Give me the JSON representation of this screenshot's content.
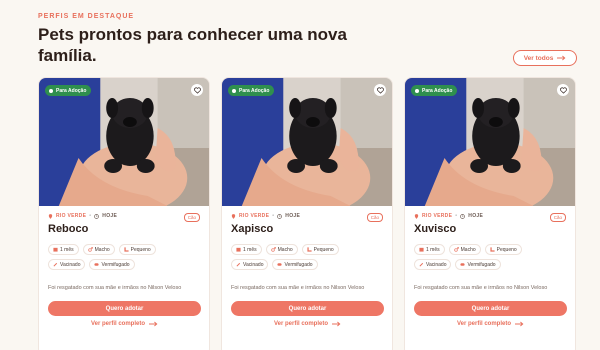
{
  "section": {
    "eyebrow": "PERFIS EM DESTAQUE",
    "headline": "Pets prontos para conhecer uma nova família.",
    "see_all": "Ver todos"
  },
  "colors": {
    "accent": "#e8705c",
    "badge_green": "#2f8f4e",
    "cta": "#ee7665"
  },
  "cards": [
    {
      "badge": "Para Adoção",
      "city": "RIO VERDE",
      "when": "HOJE",
      "species": "Cão",
      "name": "Reboco",
      "tags": [
        "1 mês",
        "Macho",
        "Pequeno",
        "Vacinado",
        "Vermifugado"
      ],
      "description": "Foi resgatado com sua mãe e irmãos no Nilson Veloso",
      "cta": "Quero adotar",
      "link": "Ver perfil completo"
    },
    {
      "badge": "Para Adoção",
      "city": "RIO VERDE",
      "when": "HOJE",
      "species": "Cão",
      "name": "Xapisco",
      "tags": [
        "1 mês",
        "Macho",
        "Pequeno",
        "Vacinado",
        "Vermifugado"
      ],
      "description": "Foi resgatado com sua mãe e irmãos no Nilson Veloso",
      "cta": "Quero adotar",
      "link": "Ver perfil completo"
    },
    {
      "badge": "Para Adoção",
      "city": "RIO VERDE",
      "when": "HOJE",
      "species": "Cão",
      "name": "Xuvisco",
      "tags": [
        "1 mês",
        "Macho",
        "Pequeno",
        "Vacinado",
        "Vermifugado"
      ],
      "description": "Foi resgatado com sua mãe e irmãos no Nilson Veloso",
      "cta": "Quero adotar",
      "link": "Ver perfil completo"
    }
  ],
  "tag_icons": [
    "calendar-icon",
    "male-icon",
    "size-icon",
    "syringe-icon",
    "pill-icon"
  ]
}
